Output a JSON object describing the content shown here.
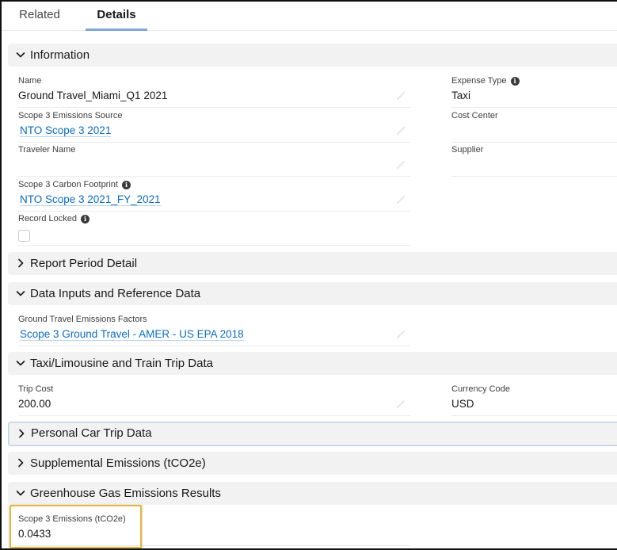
{
  "tabs": [
    {
      "label": "Related",
      "active": false
    },
    {
      "label": "Details",
      "active": true
    }
  ],
  "sections": {
    "information": {
      "title": "Information",
      "expanded": true,
      "fields": {
        "name": {
          "label": "Name",
          "value": "Ground Travel_Miami_Q1 2021"
        },
        "emissions_source": {
          "label": "Scope 3 Emissions Source",
          "value": "NTO Scope 3 2021"
        },
        "traveler_name": {
          "label": "Traveler Name",
          "value": ""
        },
        "carbon_footprint": {
          "label": "Scope 3 Carbon Footprint",
          "value": "NTO Scope 3 2021_FY_2021"
        },
        "record_locked": {
          "label": "Record Locked",
          "checked": false
        },
        "expense_type": {
          "label": "Expense Type",
          "value": "Taxi"
        },
        "cost_center": {
          "label": "Cost Center",
          "value": ""
        },
        "supplier": {
          "label": "Supplier",
          "value": ""
        }
      }
    },
    "report_period": {
      "title": "Report Period Detail",
      "expanded": false
    },
    "data_inputs": {
      "title": "Data Inputs and Reference Data",
      "expanded": true,
      "fields": {
        "ground_travel_factors": {
          "label": "Ground Travel Emissions Factors",
          "value": "Scope 3 Ground Travel - AMER - US EPA 2018"
        }
      }
    },
    "taxi_train": {
      "title": "Taxi/Limousine and Train Trip Data",
      "expanded": true,
      "fields": {
        "trip_cost": {
          "label": "Trip Cost",
          "value": "200.00"
        },
        "currency_code": {
          "label": "Currency Code",
          "value": "USD"
        }
      }
    },
    "personal_car": {
      "title": "Personal Car Trip Data",
      "expanded": false
    },
    "supplemental": {
      "title": "Supplemental Emissions (tCO2e)",
      "expanded": false
    },
    "ghg_results": {
      "title": "Greenhouse Gas Emissions Results",
      "expanded": true,
      "fields": {
        "scope3_emissions": {
          "label": "Scope 3 Emissions (tCO2e)",
          "value": "0.0433"
        }
      }
    }
  },
  "icons": {
    "expanded": "chevron-down-icon",
    "collapsed": "chevron-right-icon",
    "info": "info-icon",
    "edit": "pencil-icon"
  },
  "colors": {
    "link": "#0b6cc4",
    "active_tab_underline": "#7fa6d6",
    "section_bg": "#f2f2f2",
    "highlight_border": "#e8b53a",
    "focus_outline": "#b7cde6"
  },
  "info_glyph": "i"
}
